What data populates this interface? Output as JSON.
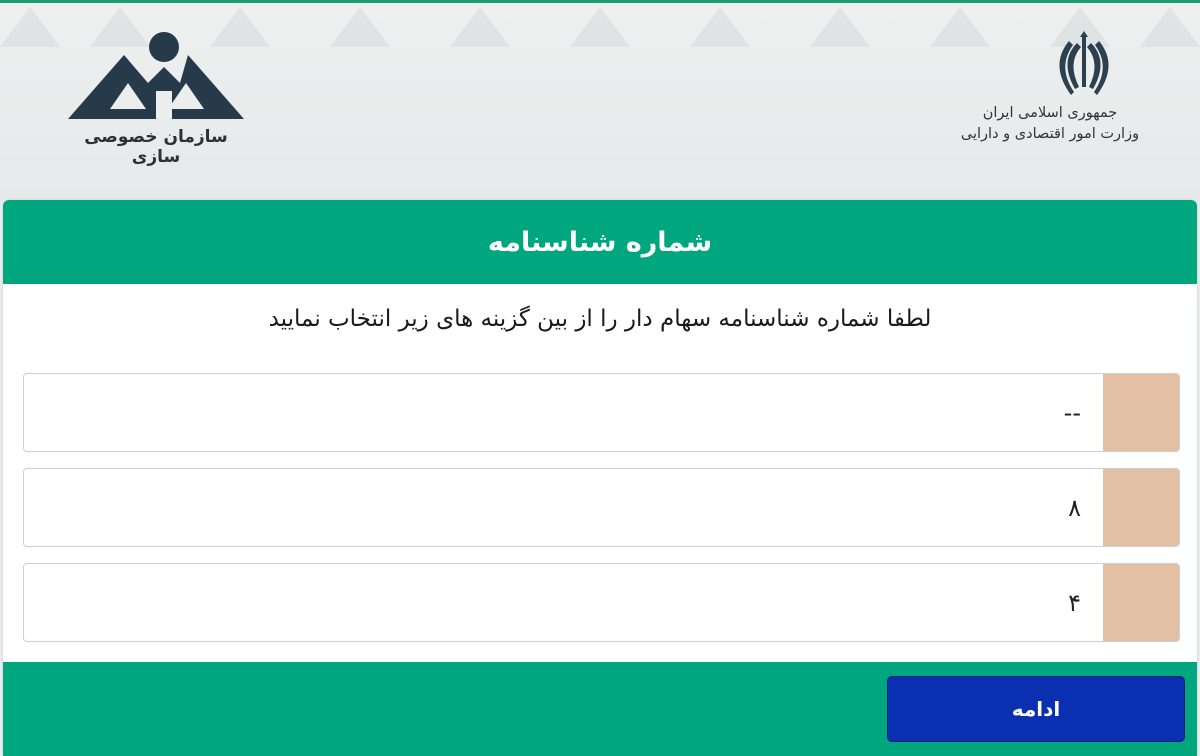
{
  "header": {
    "org_name": "سازمان خصوصی سازی",
    "gov_line1": "جمهوری اسلامی ایران",
    "gov_line2": "وزارت امور اقتصادی و دارایی"
  },
  "card": {
    "title": "شماره شناسنامه",
    "prompt": "لطفا شماره شناسنامه سهام دار را از بین گزینه های زیر انتخاب نمایید",
    "options": [
      {
        "label": "--"
      },
      {
        "label": "۸"
      },
      {
        "label": "۴"
      }
    ],
    "continue_label": "ادامه"
  },
  "colors": {
    "accent": "#00a67d",
    "radio_bg": "#e3c0a3",
    "button": "#0a2fb0"
  }
}
